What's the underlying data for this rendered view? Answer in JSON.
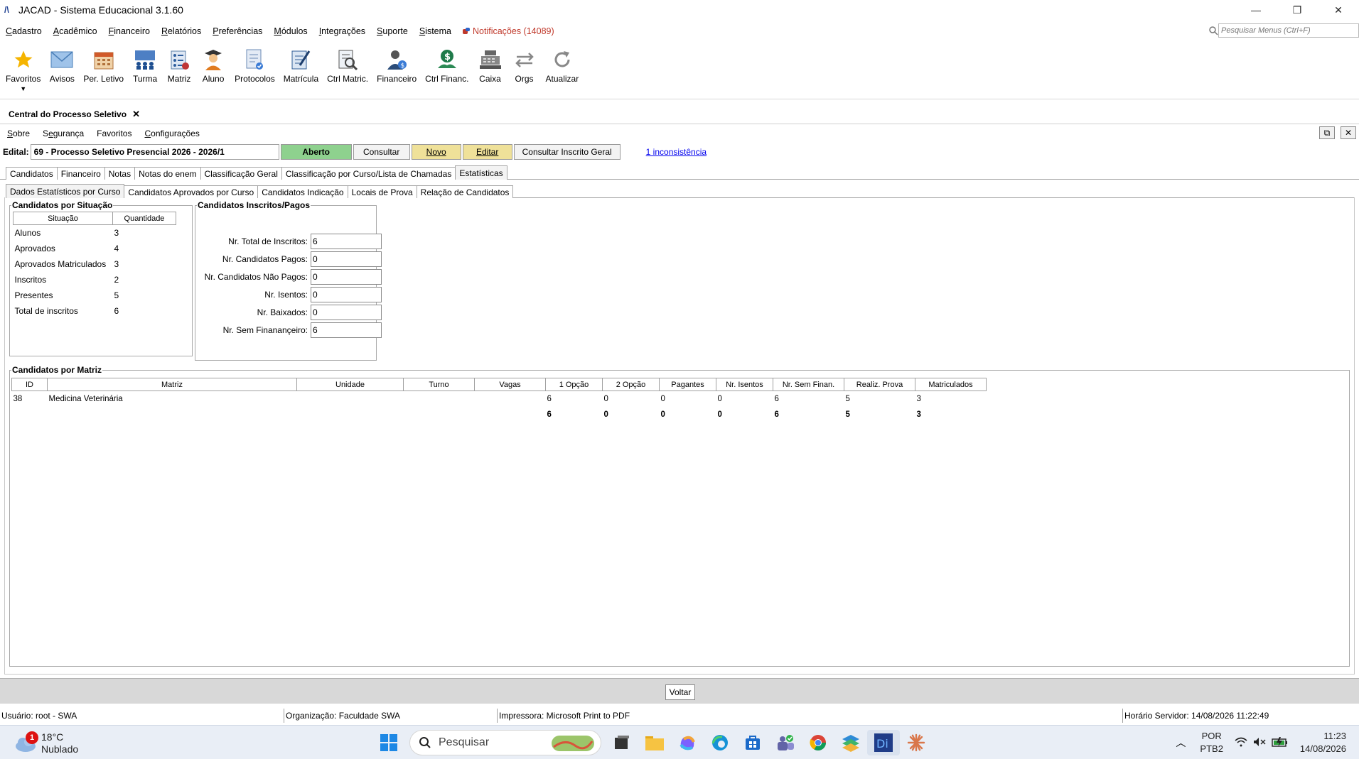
{
  "window": {
    "title": "JACAD - Sistema Educacional 3.1.60"
  },
  "menu": {
    "items": [
      {
        "label": "Cadastro",
        "u": "C"
      },
      {
        "label": "Acadêmico",
        "u": "A"
      },
      {
        "label": "Financeiro",
        "u": "F"
      },
      {
        "label": "Relatórios",
        "u": "R"
      },
      {
        "label": "Preferências",
        "u": "P"
      },
      {
        "label": "Módulos",
        "u": "M"
      },
      {
        "label": "Integrações",
        "u": "I"
      },
      {
        "label": "Suporte",
        "u": "S"
      },
      {
        "label": "Sistema",
        "u": "S"
      }
    ],
    "notifications": "Notificações (14089)",
    "search_placeholder": "Pesquisar Menus (Ctrl+F)"
  },
  "toolbar": [
    {
      "label": "Favoritos",
      "icon": "star-icon"
    },
    {
      "label": "Avisos",
      "icon": "mail-icon"
    },
    {
      "label": "Per. Letivo",
      "icon": "calendar-icon"
    },
    {
      "label": "Turma",
      "icon": "class-icon"
    },
    {
      "label": "Matriz",
      "icon": "matrix-icon"
    },
    {
      "label": "Aluno",
      "icon": "student-icon"
    },
    {
      "label": "Protocolos",
      "icon": "protocol-icon"
    },
    {
      "label": "Matrícula",
      "icon": "enrollment-icon"
    },
    {
      "label": "Ctrl Matric.",
      "icon": "enrollment-control-icon"
    },
    {
      "label": "Financeiro",
      "icon": "finance-icon"
    },
    {
      "label": "Ctrl Financ.",
      "icon": "finance-control-icon"
    },
    {
      "label": "Caixa",
      "icon": "cash-register-icon"
    },
    {
      "label": "Orgs",
      "icon": "swap-icon"
    },
    {
      "label": "Atualizar",
      "icon": "refresh-icon"
    }
  ],
  "doc_tab": {
    "title": "Central do Processo Seletivo",
    "close": "✕"
  },
  "submenu": [
    "Sobre",
    "Segurança",
    "Favoritos",
    "Configurações"
  ],
  "edital": {
    "label": "Edital:",
    "value": "69 - Processo Seletivo Presencial 2026 - 2026/1",
    "status": "Aberto",
    "consultar": "Consultar",
    "novo": "Novo",
    "editar": "Editar",
    "consultar_geral": "Consultar Inscrito Geral",
    "inconsistencia": "1 inconsistência"
  },
  "tabs_main": [
    "Candidatos",
    "Financeiro",
    "Notas",
    "Notas do enem",
    "Classificação Geral",
    "Classificação por Curso/Lista de Chamadas",
    "Estatísticas"
  ],
  "tabs_sub": [
    "Dados Estatísticos por Curso",
    "Candidatos Aprovados por Curso",
    "Candidatos Indicação",
    "Locais de Prova",
    "Relação de Candidatos"
  ],
  "situacao": {
    "title": "Candidatos por Situação",
    "headers": [
      "Situação",
      "Quantidade"
    ],
    "rows": [
      [
        "Alunos",
        "3"
      ],
      [
        "Aprovados",
        "4"
      ],
      [
        "Aprovados Matriculados",
        "3"
      ],
      [
        "Inscritos",
        "2"
      ],
      [
        "Presentes",
        "5"
      ],
      [
        "Total de inscritos",
        "6"
      ]
    ]
  },
  "inscritos": {
    "title": "Candidatos Inscritos/Pagos",
    "fields": [
      {
        "label": "Nr. Total de Inscritos:",
        "value": "6"
      },
      {
        "label": "Nr. Candidatos Pagos:",
        "value": "0"
      },
      {
        "label": "Nr. Candidatos Não Pagos:",
        "value": "0"
      },
      {
        "label": "Nr. Isentos:",
        "value": "0"
      },
      {
        "label": "Nr. Baixados:",
        "value": "0"
      },
      {
        "label": "Nr. Sem Finanançeiro:",
        "value": "6"
      }
    ]
  },
  "matriz": {
    "title": "Candidatos por Matriz",
    "headers": [
      "ID",
      "Matriz",
      "Unidade",
      "Turno",
      "Vagas",
      "1 Opção",
      "2 Opção",
      "Pagantes",
      "Nr. Isentos",
      "Nr. Sem Finan.",
      "Realiz. Prova",
      "Matriculados"
    ],
    "rows": [
      [
        "38",
        "Medicina Veterinária",
        "",
        "",
        "",
        "6",
        "0",
        "0",
        "0",
        "6",
        "5",
        "3"
      ]
    ],
    "totals": [
      "",
      "",
      "",
      "",
      "",
      "6",
      "0",
      "0",
      "0",
      "6",
      "5",
      "3"
    ]
  },
  "voltar": "Voltar",
  "status": {
    "usuario": "Usuário: root - SWA",
    "organizacao": "Organização: Faculdade SWA",
    "impressora": "Impressora: Microsoft Print to PDF",
    "horario": "Horário Servidor: 14/08/2026 11:22:49"
  },
  "taskbar": {
    "weather_badge": "1",
    "temperature": "18°C",
    "condition": "Nublado",
    "search": "Pesquisar",
    "lang1": "POR",
    "lang2": "PTB2",
    "time": "11:23",
    "date": "14/08/2026"
  }
}
